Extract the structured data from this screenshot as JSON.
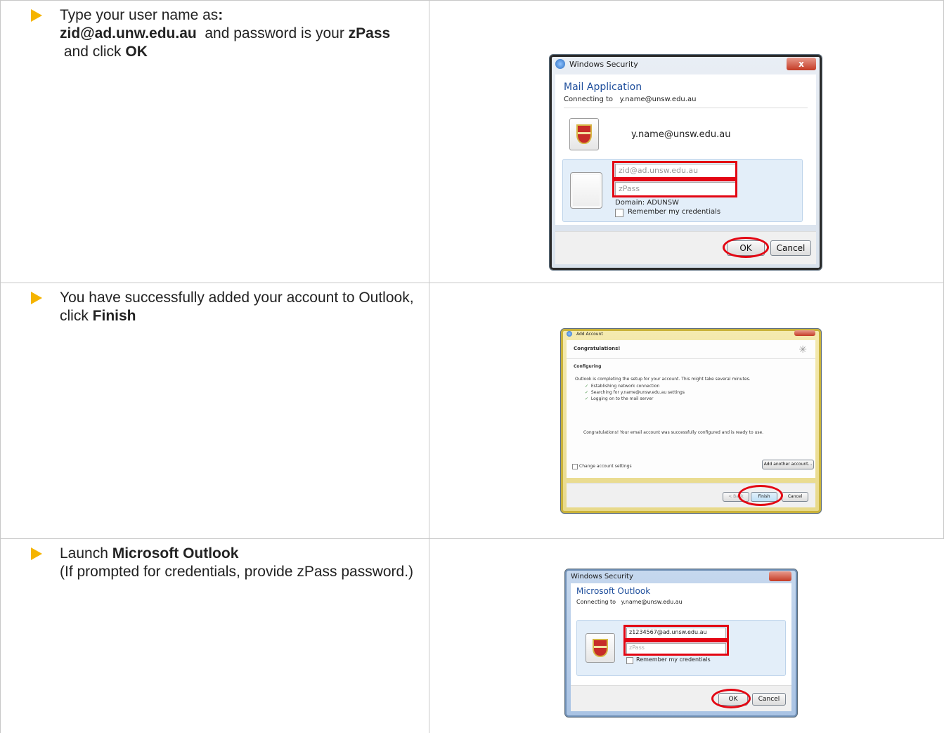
{
  "rows": [
    {
      "instruction": {
        "prefix": "Type your user name as",
        "colon": ":",
        "username": "zid@ad.unw.edu.au",
        "mid": "  and password is your ",
        "password": "zPass",
        "and_click": " and click ",
        "action": "OK"
      },
      "dialog": {
        "title": "Windows Security",
        "close": "x",
        "heading": "Mail Application",
        "connecting_label": "Connecting to",
        "connecting_value": "y.name@unsw.edu.au",
        "saved_user": "y.name@unsw.edu.au",
        "username_field": "zid@ad.unsw.edu.au",
        "password_field": "zPass",
        "domain": "Domain: ADUNSW",
        "remember": "Remember my credentials",
        "ok": "OK",
        "cancel": "Cancel"
      }
    },
    {
      "instruction": {
        "text": "You have successfully added your account to Outlook, click ",
        "action": "Finish"
      },
      "dialog": {
        "title": "Add Account",
        "heading": "Congratulations!",
        "section": "Configuring",
        "intro": "Outlook is completing the setup for your account. This might take several minutes.",
        "steps": [
          "Establishing network connection",
          "Searching for   y.name@unsw.edu.au settings",
          "Logging on to the mail server"
        ],
        "message": "Congratulations! Your email account was successfully configured and is ready to use.",
        "change_settings": "Change account settings",
        "add_another": "Add another account...",
        "back": "< Back",
        "finish": "Finish",
        "cancel": "Cancel"
      }
    },
    {
      "instruction": {
        "prefix": "Launch ",
        "app": "Microsoft Outlook",
        "note": "(If prompted for credentials, provide zPass password.)"
      },
      "dialog": {
        "title": "Windows Security",
        "heading": "Microsoft Outlook",
        "connecting_label": "Connecting to",
        "connecting_value": "y.name@unsw.edu.au",
        "username_field": "z1234567@ad.unsw.edu.au",
        "password_field": "zPass",
        "remember": "Remember my credentials",
        "ok": "OK",
        "cancel": "Cancel"
      }
    }
  ],
  "colors": {
    "arrow": "#f5b400",
    "highlight": "#e30613",
    "heading_blue": "#1e4e9c"
  }
}
